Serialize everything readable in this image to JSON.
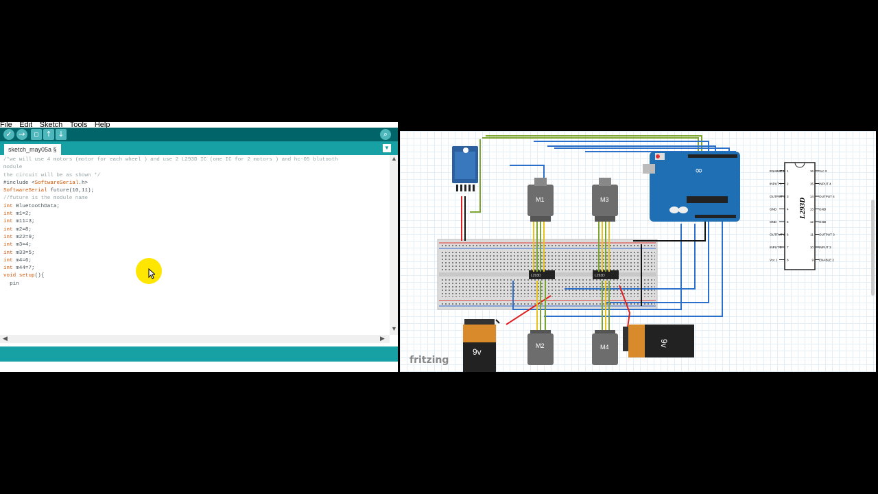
{
  "ide": {
    "menu": [
      "File",
      "Edit",
      "Sketch",
      "Tools",
      "Help"
    ],
    "toolbar": {
      "verify_icon": "check-icon",
      "upload_icon": "arrow-right-icon",
      "new_icon": "new-file-icon",
      "open_icon": "open-icon",
      "save_icon": "save-icon",
      "monitor_icon": "serial-monitor-icon"
    },
    "tab_label": "sketch_may05a §",
    "code_lines": [
      "/*we will use 4 motors (motor for each wheel ) and use 2 L293D IC (one IC for 2 motors ) and hc-05 blutooth",
      "module",
      "the circuit will be as shown */",
      "#include <SoftwareSerial.h>",
      "SoftwareSerial future(10,11);",
      "//future is the module name",
      "int BluetoothData;",
      "int m1=2;",
      "int m11=3;",
      "int m2=8;",
      "int m22=9;",
      "int m3=4;",
      "int m33=5;",
      "int m4=6;",
      "int m44=7;",
      "void setup(){",
      "  pin"
    ]
  },
  "fritzing": {
    "logo": "fritzing",
    "motors": [
      "M1",
      "M3",
      "M2",
      "M4"
    ],
    "battery_label": "9v",
    "ic_title": "L293D",
    "ic_chip_label": "L293D",
    "ic_pins_left": [
      "ENABLE 1",
      "INPUT 1",
      "OUTPUT 1",
      "GND",
      "GND",
      "OUTPUT 2",
      "INPUT 2",
      "Vcc 1"
    ],
    "ic_pins_right": [
      "Vcc 2",
      "INPUT 4",
      "OUTPUT 4",
      "GND",
      "GND",
      "OUTPUT 3",
      "INPUT 3",
      "ENABLE 2"
    ],
    "ic_pin_numbers_left": [
      "1",
      "2",
      "3",
      "4",
      "5",
      "6",
      "7",
      "8"
    ],
    "ic_pin_numbers_right": [
      "16",
      "15",
      "14",
      "13",
      "12",
      "11",
      "10",
      "9"
    ]
  },
  "colors": {
    "ide_teal_dark": "#006468",
    "ide_teal": "#17a1a5",
    "arduino_blue": "#1f6fb5",
    "wire_blue": "#2a6fc9",
    "wire_green": "#7da531",
    "wire_red": "#e02020",
    "cursor_highlight": "#ffe600"
  }
}
